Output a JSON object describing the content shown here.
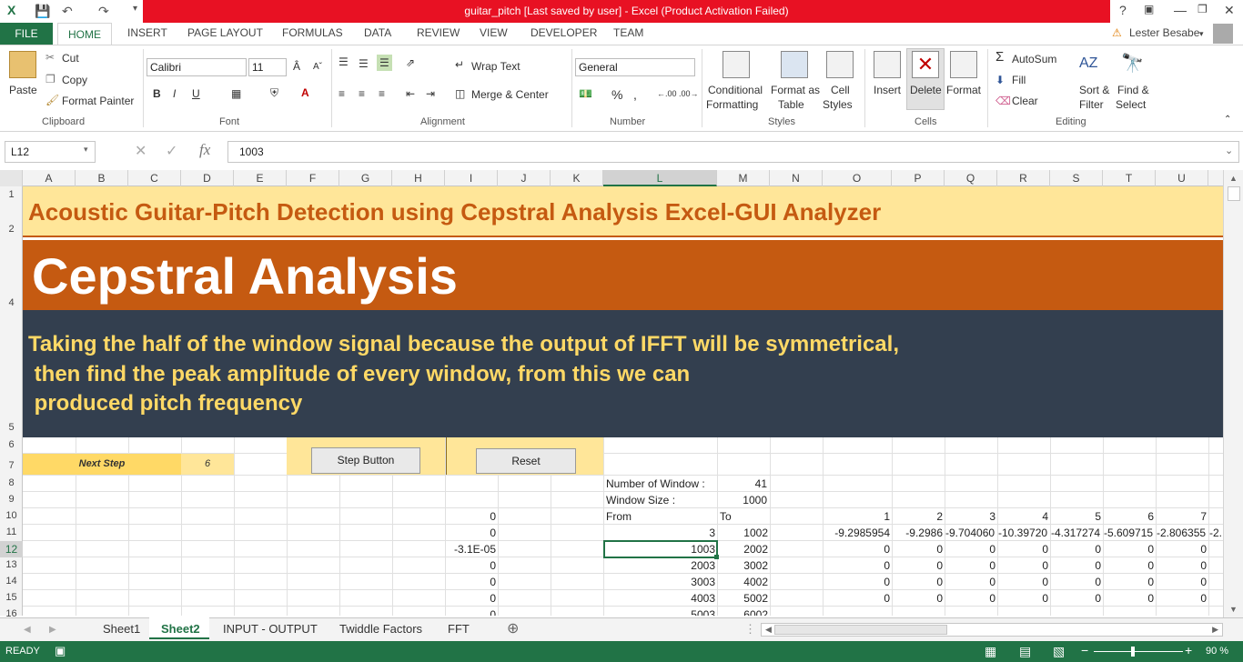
{
  "title": "guitar_pitch [Last saved by user] -  Excel (Product Activation Failed)",
  "tabs": [
    "FILE",
    "HOME",
    "INSERT",
    "PAGE LAYOUT",
    "FORMULAS",
    "DATA",
    "REVIEW",
    "VIEW",
    "DEVELOPER",
    "TEAM"
  ],
  "user": "Lester Besabe",
  "ribbon": {
    "clipboard": {
      "paste": "Paste",
      "cut": "Cut",
      "copy": "Copy",
      "format_painter": "Format Painter",
      "label": "Clipboard"
    },
    "font": {
      "name": "Calibri",
      "size": "11",
      "label": "Font"
    },
    "alignment": {
      "wrap": "Wrap Text",
      "merge": "Merge & Center",
      "label": "Alignment"
    },
    "number": {
      "format": "General",
      "label": "Number"
    },
    "styles": {
      "cond1": "Conditional",
      "cond2": "Formatting",
      "table1": "Format as",
      "table2": "Table",
      "cell1": "Cell",
      "cell2": "Styles",
      "label": "Styles"
    },
    "cells": {
      "insert": "Insert",
      "delete": "Delete",
      "format": "Format",
      "label": "Cells"
    },
    "editing": {
      "autosum": "AutoSum",
      "fill": "Fill",
      "clear": "Clear",
      "sort1": "Sort &",
      "sort2": "Filter",
      "find1": "Find &",
      "find2": "Select",
      "label": "Editing"
    }
  },
  "namebox": "L12",
  "formula": "1003",
  "columns": [
    "A",
    "B",
    "C",
    "D",
    "E",
    "F",
    "G",
    "H",
    "I",
    "J",
    "K",
    "L",
    "M",
    "N",
    "O",
    "P",
    "Q",
    "R",
    "S",
    "T",
    "U"
  ],
  "rows": [
    "1",
    "2",
    "4",
    "5",
    "6",
    "7",
    "8",
    "9",
    "10",
    "11",
    "12",
    "13",
    "14",
    "15",
    "16"
  ],
  "sheet": {
    "heading": "Acoustic Guitar-Pitch Detection using Cepstral Analysis Excel-GUI Analyzer",
    "big_title": "Cepstral Analysis",
    "desc1": "Taking the half of the window signal because the output of IFFT will be symmetrical,",
    "desc2": " then find the peak amplitude of every window, from this we can",
    "desc3": " produced pitch frequency",
    "next_step_label": "Next Step",
    "next_step_value": "6",
    "step_button": "Step Button",
    "reset_button": "Reset",
    "num_windows_label": "Number of Window :",
    "num_windows": "41",
    "window_size_label": "Window Size :",
    "window_size": "1000",
    "from_label": "From",
    "to_label": "To",
    "index_header": [
      "1",
      "2",
      "3",
      "4",
      "5",
      "6",
      "7"
    ],
    "col_i": [
      "0",
      "0",
      "-3.1E-05",
      "0",
      "0",
      "0",
      "0"
    ],
    "from_vals": [
      "3",
      "1003",
      "2003",
      "3003",
      "4003",
      "5003"
    ],
    "to_vals": [
      "1002",
      "2002",
      "3002",
      "4002",
      "5002",
      "6002"
    ],
    "row11": [
      "-9.2985954",
      "-9.2986",
      "-9.704060",
      "-10.39720",
      "-4.317274",
      "-5.609715",
      "-2.806355",
      "-2."
    ],
    "zero": "0"
  },
  "sheet_tabs": [
    "Sheet1",
    "Sheet2",
    "INPUT - OUTPUT",
    "Twiddle Factors",
    "FFT"
  ],
  "status": "READY",
  "zoom": "90 %",
  "colors": {
    "excel_green": "#217346",
    "title_red": "#e81123",
    "banner_yellow": "#ffe699",
    "banner_orange": "#c55a11",
    "dark": "#333f4f",
    "text_orange": "#c55a11",
    "text_yellow": "#ffd966"
  }
}
